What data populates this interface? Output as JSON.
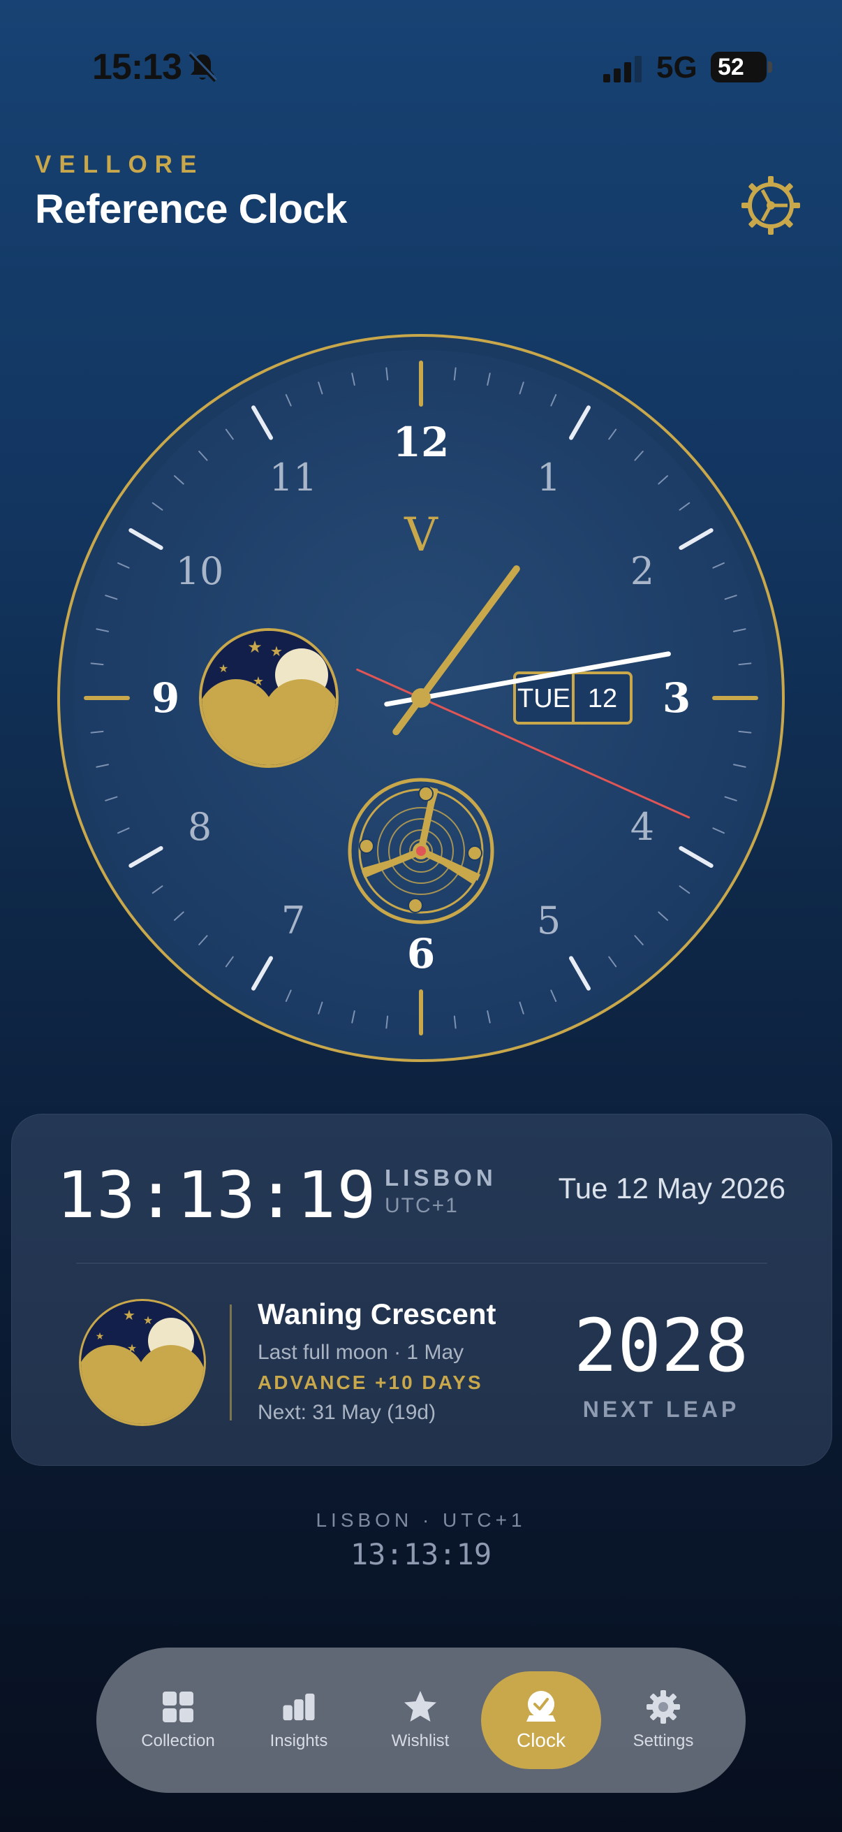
{
  "status_bar": {
    "time": "15:13",
    "network": "5G",
    "battery": "52"
  },
  "header": {
    "brand": "VELLORE",
    "title": "Reference Clock"
  },
  "clock": {
    "numerals": [
      "12",
      "1",
      "2",
      "3",
      "4",
      "5",
      "6",
      "7",
      "8",
      "9",
      "10",
      "11"
    ],
    "logo": "V",
    "day": "TUE",
    "date": "12",
    "hands": {
      "hour": 13,
      "minute": 13,
      "second": 19
    },
    "accent": "#c9a84c",
    "second_hand_color": "#e05555"
  },
  "card": {
    "digital_time": "13:13:19",
    "city": "LISBON",
    "utc": "UTC+1",
    "long_date": "Tue 12 May 2026",
    "moon_phase": "Waning Crescent",
    "last_full": "Last full moon · 1 May",
    "advance": "ADVANCE +10 DAYS",
    "next_moon": "Next: 31 May (19d)",
    "leap_year": "2028",
    "leap_label": "NEXT LEAP"
  },
  "footer": {
    "city_line": "LISBON · UTC+1",
    "time": "13:13:19"
  },
  "tabs": [
    {
      "label": "Collection",
      "icon": "grid-icon"
    },
    {
      "label": "Insights",
      "icon": "bar-chart-icon"
    },
    {
      "label": "Wishlist",
      "icon": "star-icon"
    },
    {
      "label": "Clock",
      "icon": "clock-icon",
      "active": true
    },
    {
      "label": "Settings",
      "icon": "gear-icon"
    }
  ]
}
